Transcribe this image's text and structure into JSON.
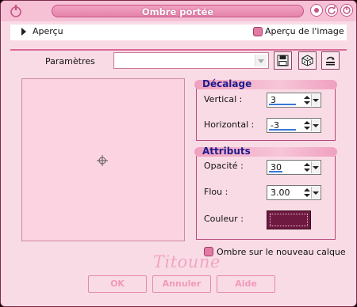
{
  "window": {
    "title": "Ombre portée"
  },
  "preview": {
    "label": "Aperçu",
    "image_preview_label": "Aperçu de l'image",
    "image_preview_checked": true
  },
  "params": {
    "label": "Paramètres",
    "value": ""
  },
  "decalage": {
    "title": "Décalage",
    "vertical_label": "Vertical :",
    "vertical_value": "3",
    "horizontal_label": "Horizontal :",
    "horizontal_value": "-3"
  },
  "attributs": {
    "title": "Attributs",
    "opacite_label": "Opacité :",
    "opacite_value": "30",
    "flou_label": "Flou :",
    "flou_value": "3.00",
    "couleur_label": "Couleur :",
    "couleur_value": "#6e1a40"
  },
  "new_layer": {
    "label": "Ombre sur le nouveau calque",
    "checked": true
  },
  "signature": "Titoune",
  "buttons": {
    "ok": "OK",
    "cancel": "Annuler",
    "help": "Aide"
  }
}
